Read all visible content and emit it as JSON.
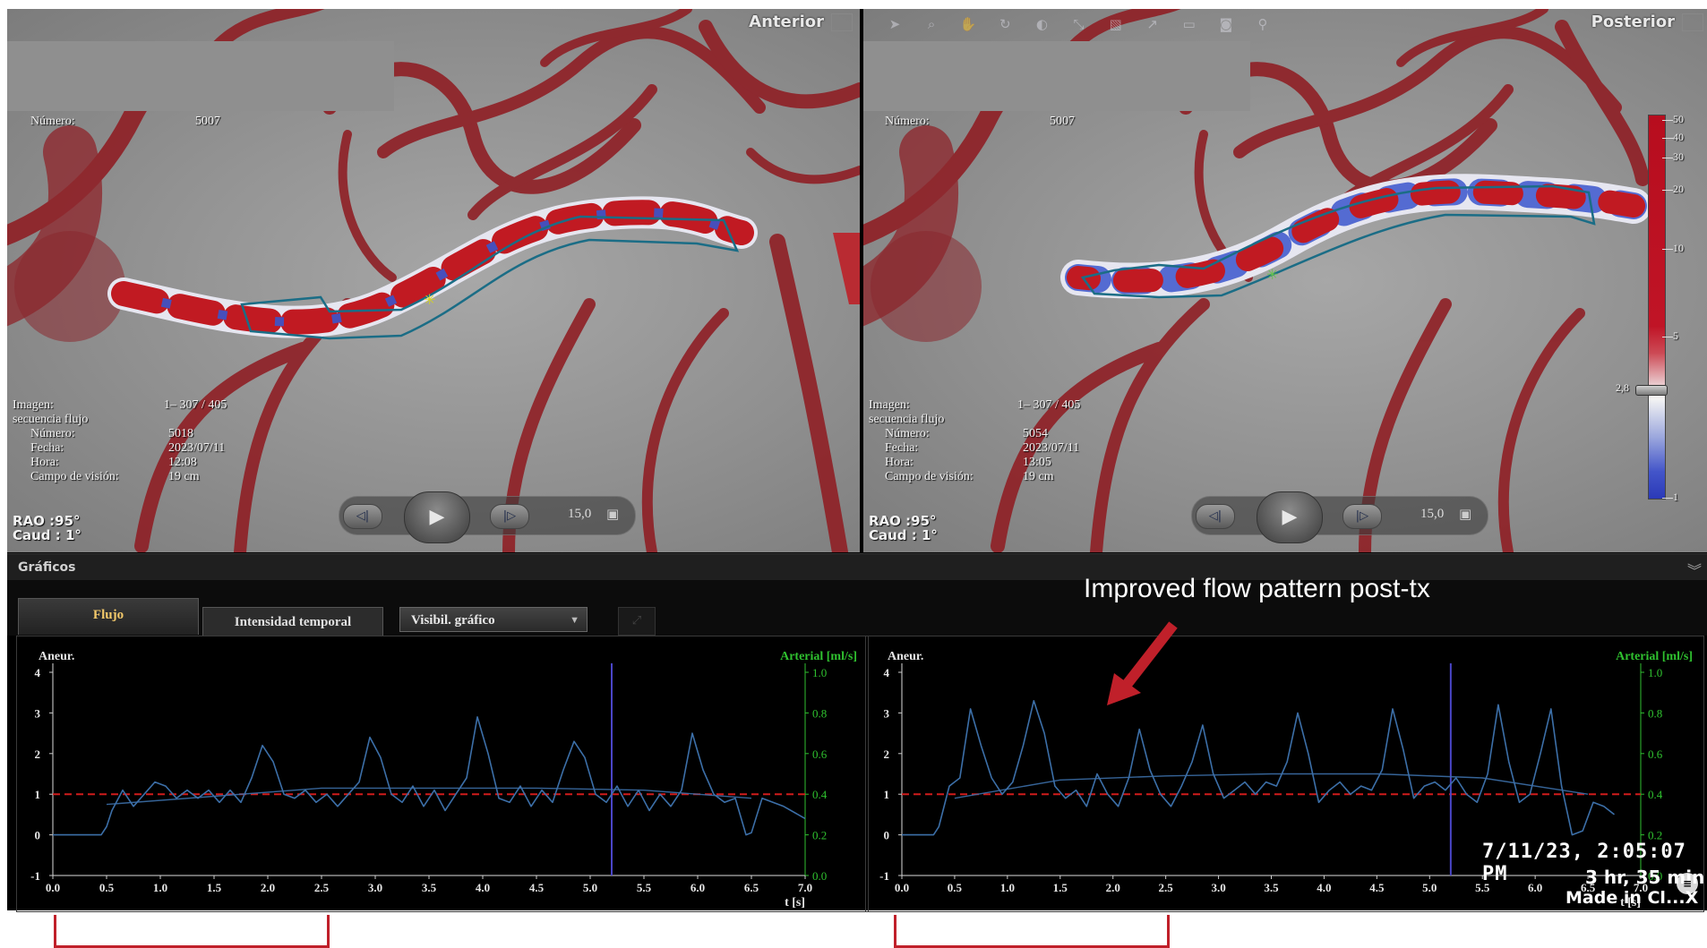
{
  "views": {
    "left": {
      "title": "Anterior",
      "numero_label": "Número:",
      "numero_value": "5007",
      "image_label": "Imagen:",
      "image_value": "1– 307 / 405",
      "sequence_label": "secuencia flujo",
      "num2_label": "Número:",
      "num2_value": "5018",
      "date_label": "Fecha:",
      "date_value": "2023/07/11",
      "time_label": "Hora:",
      "time_value": "12:08",
      "fov_label": "Campo de visión:",
      "fov_value": "19 cm",
      "rao": "RAO :95°",
      "caud": "Caud :  1°",
      "rate": "15,0"
    },
    "right": {
      "title": "Posterior",
      "numero_label": "Número:",
      "numero_value": "5007",
      "image_label": "Imagen:",
      "image_value": "1– 307 / 405",
      "sequence_label": "secuencia flujo",
      "num2_label": "Número:",
      "num2_value": "5054",
      "date_label": "Fecha:",
      "date_value": "2023/07/11",
      "time_label": "Hora:",
      "time_value": "13:05",
      "fov_label": "Campo de visión:",
      "fov_value": "19 cm",
      "rao": "RAO :95°",
      "caud": "Caud :  1°",
      "rate": "15,0"
    }
  },
  "colorbar": {
    "labels": [
      "50",
      "40",
      "30",
      "20",
      "10",
      "5",
      "2,8",
      "1"
    ],
    "colors": {
      "high": "#b70d1e",
      "mid": "#f3f3f3",
      "low": "#2b3ab8"
    }
  },
  "panel": {
    "title": "Gráficos",
    "tabs": [
      "Flujo",
      "Intensidad temporal"
    ],
    "select_value": "Visibil. gráfico"
  },
  "graphs": {
    "left_label": "Aneur.",
    "right_label": "Arterial [ml/s]",
    "x_label": "t [s]",
    "y_left_ticks": [
      "-1",
      "0",
      "1",
      "2",
      "3",
      "4"
    ],
    "y_right_ticks": [
      "0.0",
      "0.2",
      "0.4",
      "0.6",
      "0.8",
      "1.0"
    ],
    "x_ticks": [
      "0.0",
      "0.5",
      "1.0",
      "1.5",
      "2.0",
      "2.5",
      "3.0",
      "3.5",
      "4.0",
      "4.5",
      "5.0",
      "5.5",
      "6.0",
      "6.5",
      "7.0"
    ],
    "colors": {
      "signal": "#3c6fa8",
      "threshold": "#d01c1c",
      "cursor": "#4a46c8",
      "right_axis": "#2fc12f"
    }
  },
  "annotations": {
    "text": "Improved flow pattern post-tx",
    "arrow_color": "#c0202a"
  },
  "video": {
    "timestamp": "7/11/23, 2:05:07 PM",
    "duration": "3 hr, 35 min",
    "made_in": "Made in Cl...X"
  },
  "chart_data": [
    {
      "type": "line",
      "title": "",
      "xlabel": "t [s]",
      "ylabel": "Aneur.",
      "y2label": "Arterial [ml/s]",
      "xlim": [
        0.0,
        7.0
      ],
      "ylim": [
        -1,
        4
      ],
      "y2lim": [
        0.0,
        1.0
      ],
      "threshold_y": 1.0,
      "cursor_x": 5.2,
      "series": [
        {
          "name": "Aneur.",
          "x": [
            0.0,
            0.45,
            0.5,
            0.55,
            0.65,
            0.75,
            0.85,
            0.95,
            1.05,
            1.15,
            1.25,
            1.35,
            1.45,
            1.55,
            1.65,
            1.75,
            1.85,
            1.95,
            2.05,
            2.15,
            2.25,
            2.35,
            2.45,
            2.55,
            2.65,
            2.75,
            2.85,
            2.95,
            3.05,
            3.15,
            3.25,
            3.35,
            3.45,
            3.55,
            3.65,
            3.75,
            3.85,
            3.95,
            4.05,
            4.15,
            4.25,
            4.35,
            4.45,
            4.55,
            4.65,
            4.75,
            4.85,
            4.95,
            5.05,
            5.15,
            5.25,
            5.35,
            5.45,
            5.55,
            5.65,
            5.75,
            5.85,
            5.95,
            6.05,
            6.15,
            6.25,
            6.35,
            6.45,
            6.5,
            6.6,
            6.8,
            7.0
          ],
          "values": [
            0,
            0,
            0.2,
            0.6,
            1.1,
            0.7,
            1.0,
            1.3,
            1.2,
            0.9,
            1.1,
            0.9,
            1.1,
            0.8,
            1.1,
            0.8,
            1.4,
            2.2,
            1.8,
            1.0,
            0.9,
            1.1,
            0.8,
            1.0,
            0.7,
            1.0,
            1.3,
            2.4,
            1.9,
            1.0,
            0.8,
            1.2,
            0.7,
            1.1,
            0.6,
            1.0,
            1.4,
            2.9,
            2.0,
            0.9,
            0.8,
            1.2,
            0.7,
            1.1,
            0.8,
            1.6,
            2.3,
            1.9,
            1.0,
            0.8,
            1.2,
            0.7,
            1.1,
            0.6,
            1.0,
            0.7,
            1.1,
            2.5,
            1.6,
            1.0,
            0.8,
            0.9,
            0.0,
            0.05,
            0.9,
            0.7,
            0.4
          ]
        },
        {
          "name": "Arterial [ml/s]",
          "x": [
            0.5,
            1.5,
            2.5,
            3.5,
            4.5,
            5.5,
            6.5
          ],
          "values": [
            0.35,
            0.39,
            0.43,
            0.43,
            0.43,
            0.42,
            0.38
          ]
        }
      ]
    },
    {
      "type": "line",
      "title": "",
      "xlabel": "t [s]",
      "ylabel": "Aneur.",
      "y2label": "Arterial [ml/s]",
      "xlim": [
        0.0,
        7.0
      ],
      "ylim": [
        -1,
        4
      ],
      "y2lim": [
        0.0,
        1.0
      ],
      "threshold_y": 1.0,
      "cursor_x": 5.2,
      "series": [
        {
          "name": "Aneur.",
          "x": [
            0.0,
            0.3,
            0.35,
            0.45,
            0.55,
            0.65,
            0.75,
            0.85,
            0.95,
            1.05,
            1.15,
            1.25,
            1.35,
            1.45,
            1.55,
            1.65,
            1.75,
            1.85,
            1.95,
            2.05,
            2.15,
            2.25,
            2.35,
            2.45,
            2.55,
            2.65,
            2.75,
            2.85,
            2.95,
            3.05,
            3.15,
            3.25,
            3.35,
            3.45,
            3.55,
            3.65,
            3.75,
            3.85,
            3.95,
            4.05,
            4.15,
            4.25,
            4.35,
            4.45,
            4.55,
            4.65,
            4.75,
            4.85,
            4.95,
            5.05,
            5.15,
            5.25,
            5.35,
            5.45,
            5.55,
            5.65,
            5.75,
            5.85,
            5.95,
            6.05,
            6.15,
            6.25,
            6.35,
            6.45,
            6.55,
            6.65,
            6.75
          ],
          "values": [
            0,
            0,
            0.2,
            1.2,
            1.4,
            3.1,
            2.2,
            1.4,
            1.0,
            1.3,
            2.2,
            3.3,
            2.5,
            1.2,
            0.9,
            1.1,
            0.7,
            1.5,
            1.0,
            0.7,
            1.4,
            2.6,
            1.6,
            1.0,
            0.7,
            1.2,
            1.8,
            2.7,
            1.5,
            0.9,
            1.1,
            1.3,
            1.0,
            1.3,
            1.2,
            1.8,
            3.0,
            2.0,
            0.8,
            1.1,
            1.3,
            1.0,
            1.2,
            1.1,
            1.6,
            3.1,
            2.1,
            0.9,
            1.2,
            1.3,
            1.1,
            1.4,
            1.0,
            0.8,
            1.5,
            3.2,
            1.8,
            0.8,
            1.0,
            2.0,
            3.1,
            1.2,
            0.0,
            0.1,
            0.8,
            0.7,
            0.5
          ]
        },
        {
          "name": "Arterial [ml/s]",
          "x": [
            0.5,
            1.5,
            2.5,
            3.5,
            4.5,
            5.5,
            6.5
          ],
          "values": [
            0.38,
            0.47,
            0.49,
            0.5,
            0.5,
            0.48,
            0.4
          ]
        }
      ]
    }
  ]
}
